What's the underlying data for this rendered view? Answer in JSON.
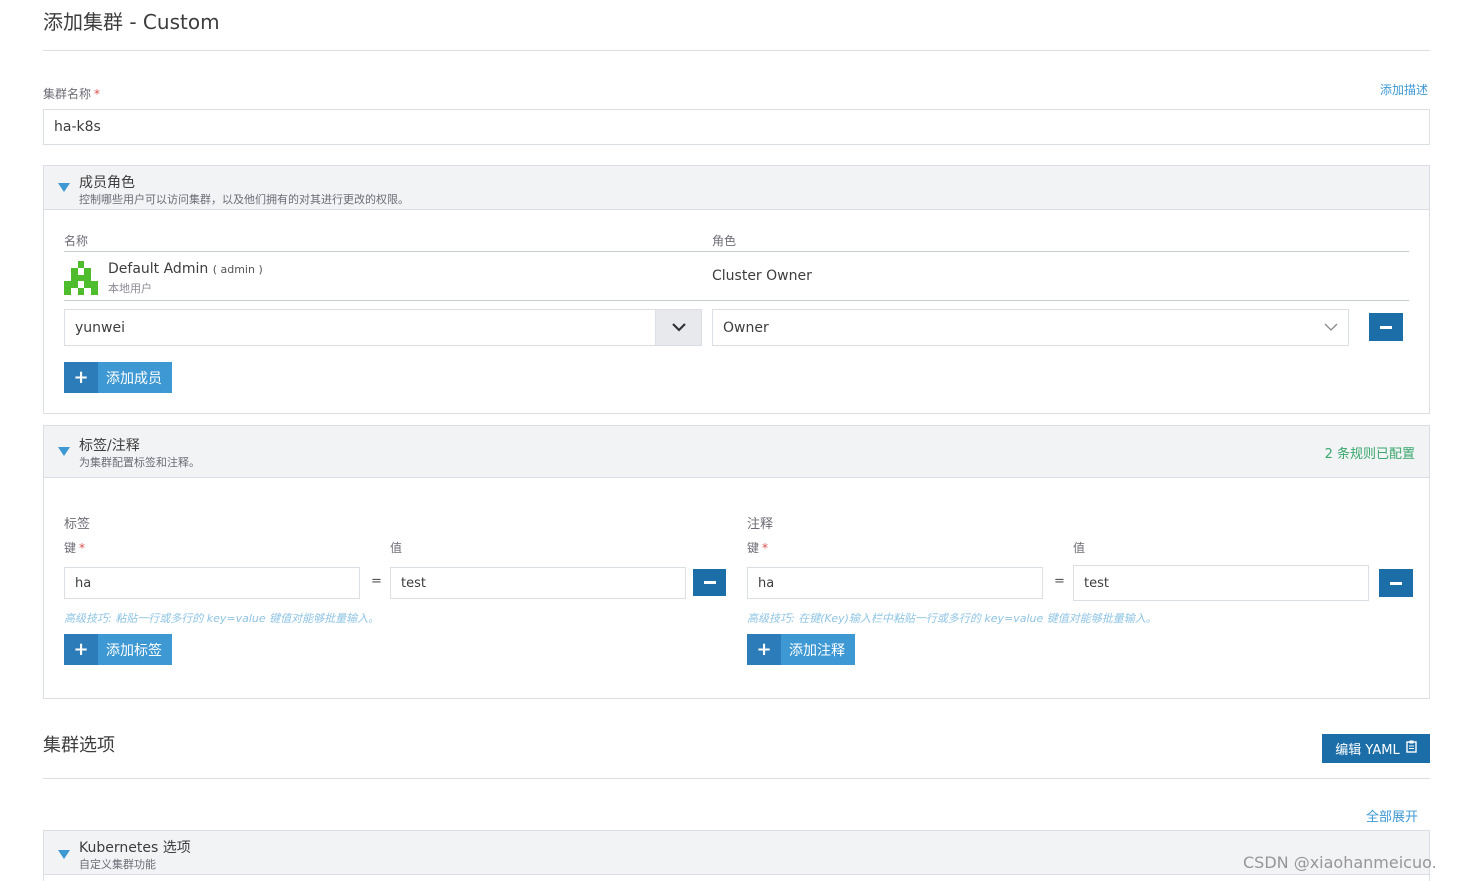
{
  "header": {
    "title": "添加集群 - Custom"
  },
  "cluster_name": {
    "label": "集群名称",
    "required_mark": "*",
    "add_description_link": "添加描述",
    "value": "ha-k8s"
  },
  "members": {
    "title": "成员角色",
    "subtitle": "控制哪些用户可以访问集群，以及他们拥有的对其进行更改的权限。",
    "col_name": "名称",
    "col_role": "角色",
    "default_user": {
      "name": "Default Admin",
      "username": "( admin )",
      "type": "本地用户",
      "role": "Cluster Owner"
    },
    "new_member": {
      "user": "yunwei",
      "role": "Owner"
    },
    "add_button": "添加成员",
    "accent": "#3d98d3"
  },
  "labels_annotations": {
    "title": "标签/注释",
    "subtitle": "为集群配置标签和注释。",
    "status": "2 条规则已配置",
    "status_color": "#3aa76d",
    "labels": {
      "heading": "标签",
      "key_label": "键",
      "value_label": "值",
      "key": "ha",
      "value": "test",
      "hint": "高级技巧: 粘贴一行或多行的 key=value 键值对能够批量输入。",
      "add_button": "添加标签"
    },
    "annotations": {
      "heading": "注释",
      "key_label": "键",
      "value_label": "值",
      "key": "ha",
      "value": "test",
      "hint": "高级技巧: 在键(Key)输入栏中粘贴一行或多行的 key=value 键值对能够批量输入。",
      "add_button": "添加注释"
    },
    "eq_sign": "="
  },
  "cluster_options": {
    "title": "集群选项",
    "edit_yaml": "编辑 YAML",
    "expand_all": "全部展开",
    "kubernetes": {
      "title": "Kubernetes 选项",
      "subtitle": "自定义集群功能"
    }
  },
  "watermark": "CSDN @xiaohanmeicuo."
}
